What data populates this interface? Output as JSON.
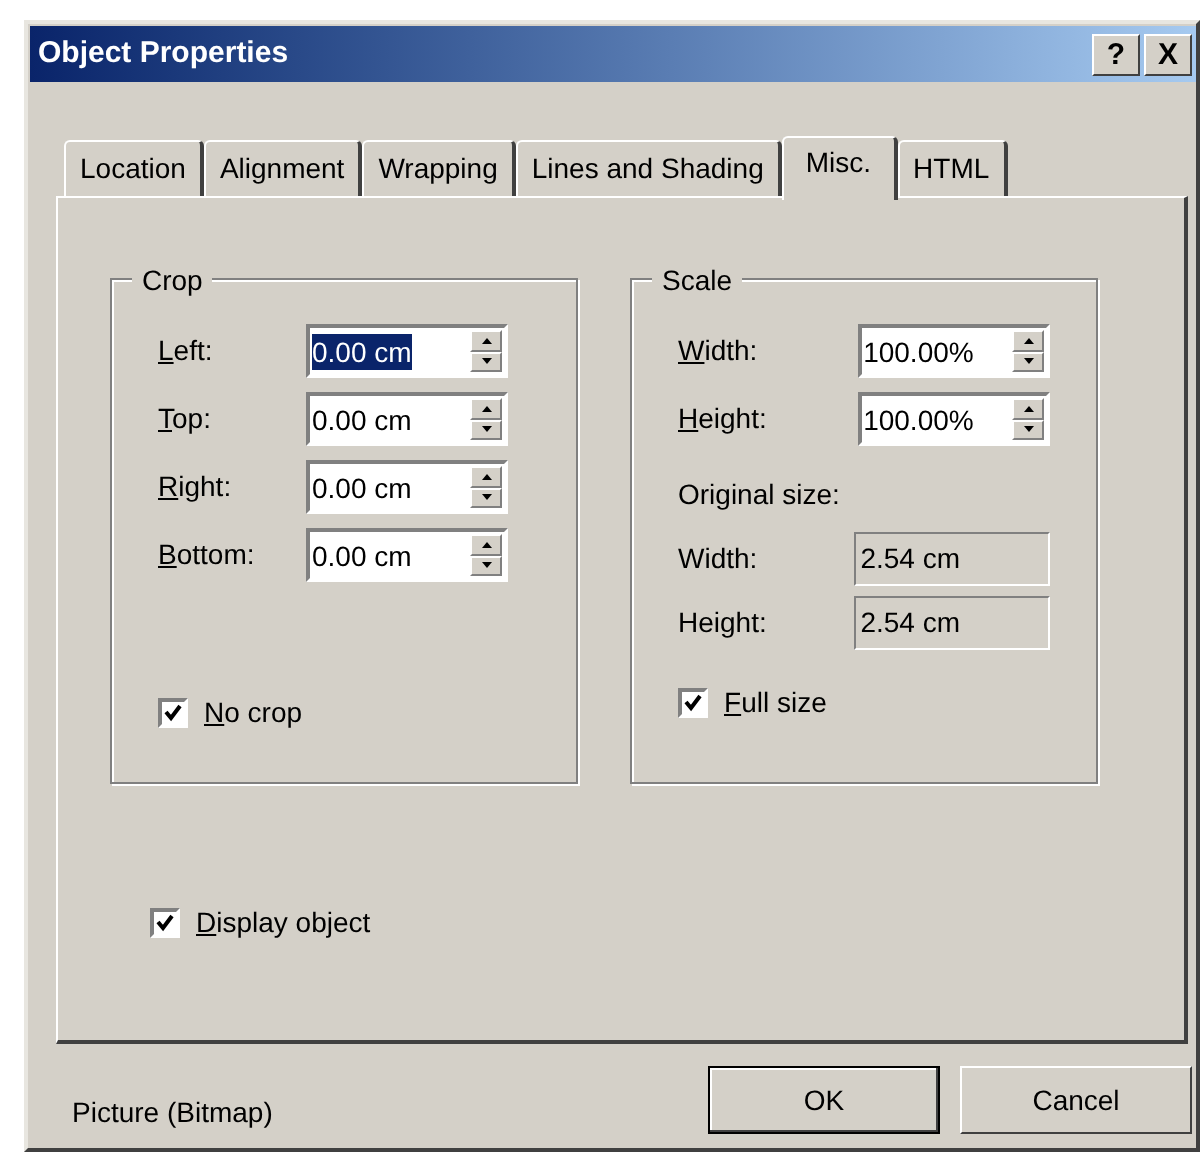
{
  "window": {
    "title": "Object Properties",
    "title_buttons": [
      "?",
      "X"
    ]
  },
  "tabs": [
    {
      "label": "Location",
      "selected": false
    },
    {
      "label": "Alignment",
      "selected": false
    },
    {
      "label": "Wrapping",
      "selected": false
    },
    {
      "label": "Lines and Shading",
      "selected": false
    },
    {
      "label": "Misc.",
      "selected": true
    },
    {
      "label": "HTML",
      "selected": false
    }
  ],
  "crop": {
    "title": "Crop",
    "fields": [
      {
        "label": "Left:",
        "mnemonic": true,
        "value": "0.00 cm",
        "selected": true
      },
      {
        "label": "Top:",
        "mnemonic": true,
        "value": "0.00 cm",
        "selected": false
      },
      {
        "label": "Right:",
        "mnemonic": true,
        "value": "0.00 cm",
        "selected": false
      },
      {
        "label": "Bottom:",
        "mnemonic": true,
        "value": "0.00 cm",
        "selected": false
      }
    ],
    "checkbox": {
      "label": "No crop",
      "checked": true
    }
  },
  "scale": {
    "title": "Scale",
    "fields": [
      {
        "label": "Width:",
        "mnemonic": true,
        "value": "100.00%",
        "selected": false
      },
      {
        "label": "Height:",
        "mnemonic": true,
        "value": "100.00%",
        "selected": false
      }
    ],
    "original_size_label": "Original size:",
    "original": [
      {
        "label": "Width:",
        "value": "2.54 cm"
      },
      {
        "label": "Height:",
        "value": "2.54 cm"
      }
    ],
    "checkbox": {
      "label": "Full size",
      "checked": true
    }
  },
  "display_checkbox": {
    "label": "Display object",
    "checked": true
  },
  "status": "Picture (Bitmap)",
  "buttons": [
    {
      "label": "OK",
      "default": true
    },
    {
      "label": "Cancel",
      "default": false
    }
  ]
}
